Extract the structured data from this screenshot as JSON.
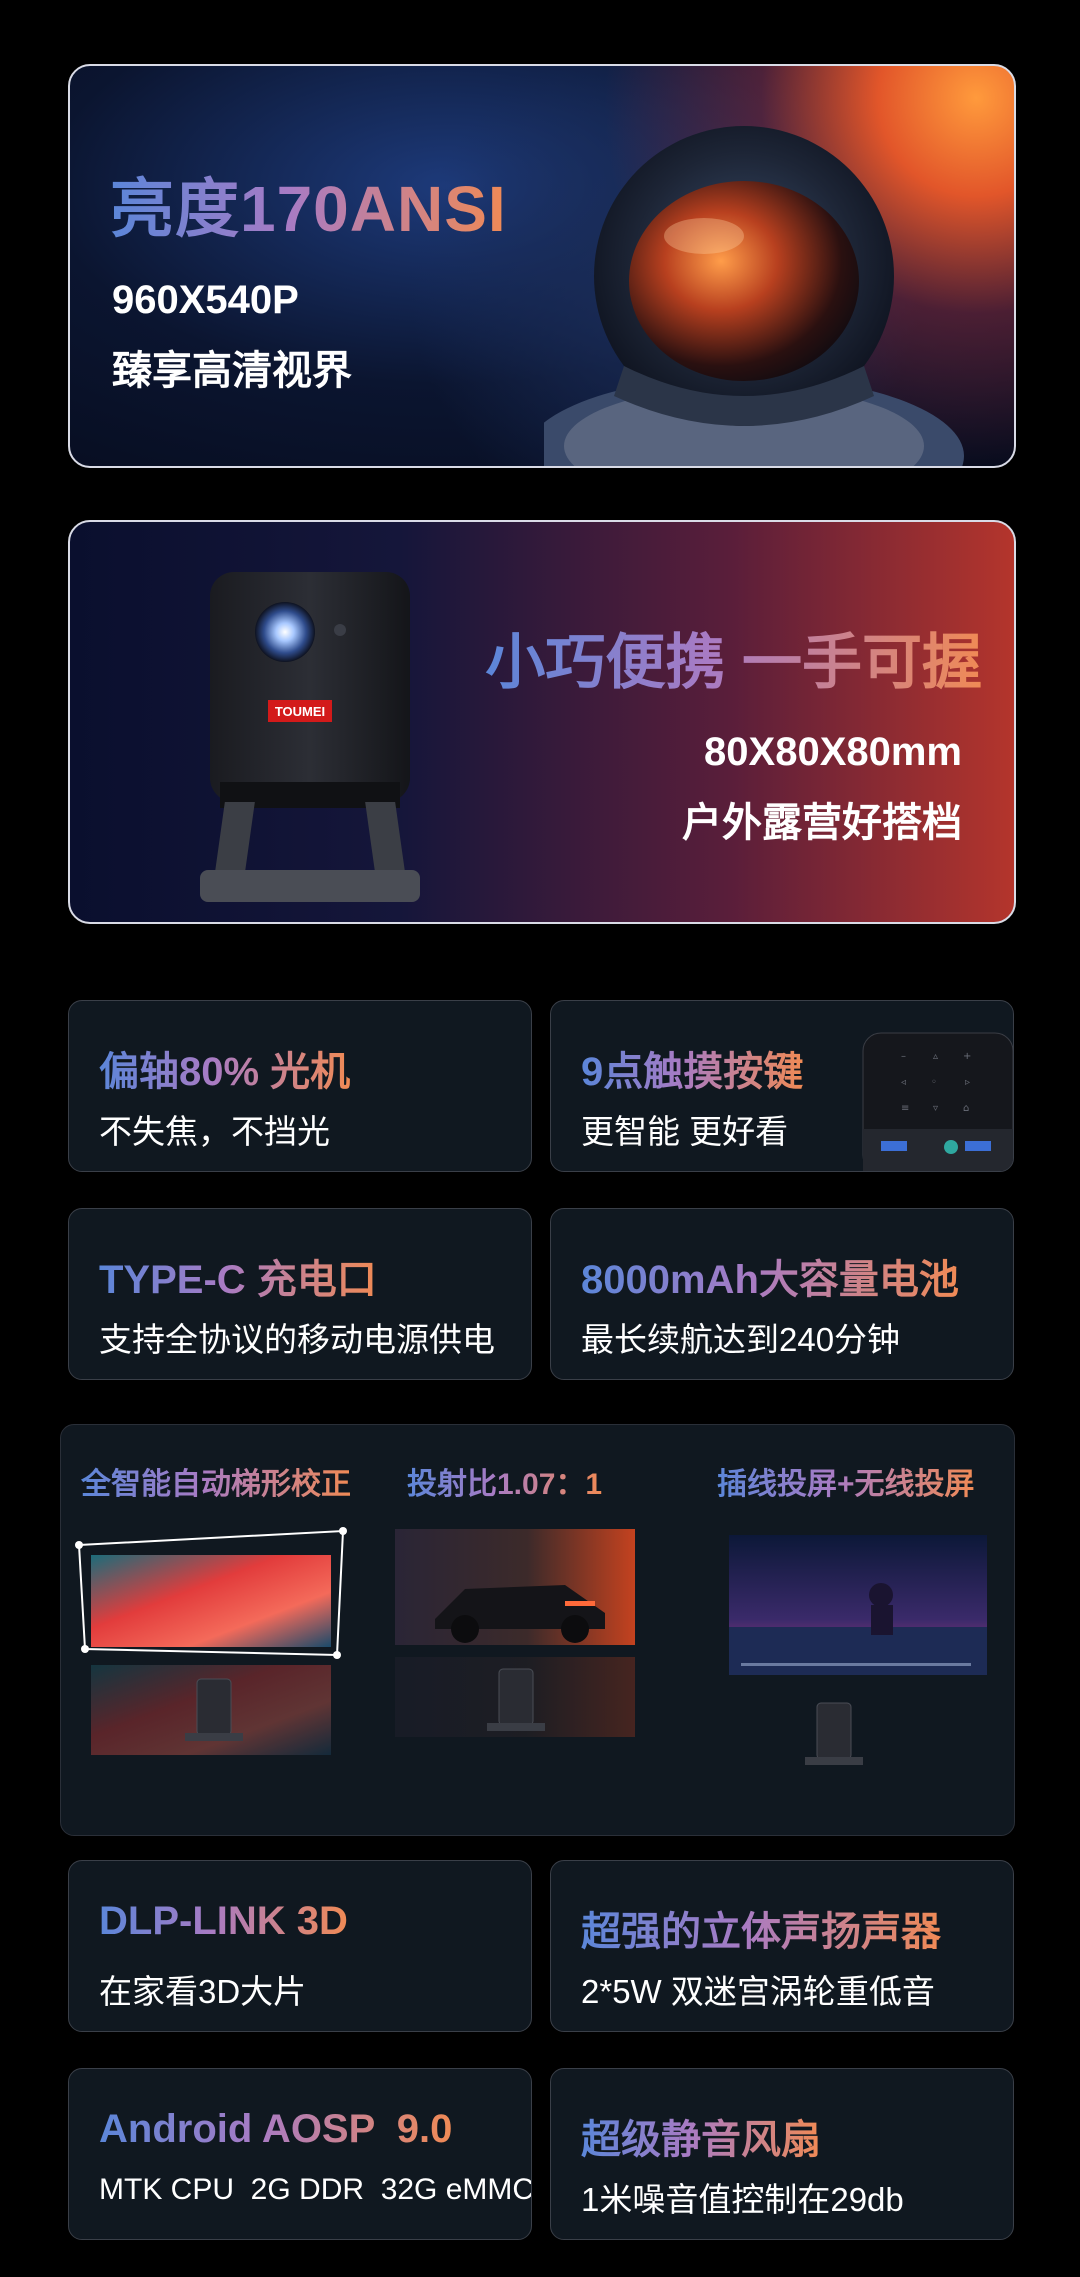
{
  "banner1": {
    "title": "亮度170ANSI",
    "line1": "960X540P",
    "line2": "臻享高清视界"
  },
  "banner2": {
    "title": "小巧便携 一手可握",
    "line1": "80X80X80mm",
    "line2": "户外露营好搭档",
    "brand": "TOUMEI"
  },
  "features": [
    {
      "title": "偏轴80% 光机",
      "desc": "不失焦，不挡光"
    },
    {
      "title": "9点触摸按键",
      "desc": "更智能 更好看"
    },
    {
      "title": "TYPE-C 充电口",
      "desc": "支持全协议的移动电源供电"
    },
    {
      "title": "8000mAh大容量电池",
      "desc": "最长续航达到240分钟"
    },
    {
      "title": "DLP-LINK 3D",
      "desc": "在家看3D大片"
    },
    {
      "title": "超强的立体声扬声器",
      "desc": "2*5W 双迷宫涡轮重低音"
    },
    {
      "title": "Android AOSP  9.0",
      "desc": "MTK CPU  2G DDR  32G eMMC"
    },
    {
      "title": "超级静音风扇",
      "desc": "1米噪音值控制在29db"
    }
  ],
  "panel": {
    "items": [
      {
        "title": "全智能自动梯形校正"
      },
      {
        "title": "投射比1.07：1"
      },
      {
        "title": "插线投屏+无线投屏"
      }
    ]
  },
  "colors": {
    "gradient_start": "#5b86d9",
    "gradient_mid": "#a87bc4",
    "gradient_end": "#f08a55",
    "card_bg": "#101820",
    "page_bg": "#000000"
  }
}
